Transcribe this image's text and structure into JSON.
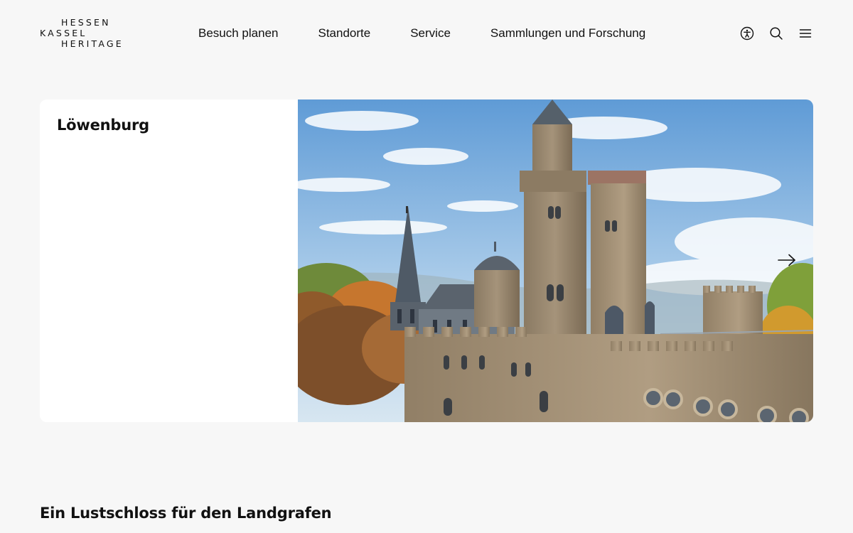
{
  "brand": {
    "line1": "HESSEN",
    "line2": "KASSEL",
    "line3": "HERITAGE"
  },
  "nav": {
    "items": [
      {
        "label": "Besuch planen"
      },
      {
        "label": "Standorte"
      },
      {
        "label": "Service"
      },
      {
        "label": "Sammlungen und Forschung"
      }
    ]
  },
  "header_actions": {
    "icons": [
      "accessibility-icon",
      "search-icon",
      "menu-icon"
    ]
  },
  "hero": {
    "title": "Löwenburg",
    "image_subject": "castle-photo",
    "next_icon": "arrow-right-icon"
  },
  "section": {
    "title": "Ein Lustschloss für den Landgrafen"
  },
  "colors": {
    "background": "#f7f7f7",
    "card": "#ffffff",
    "text": "#111111"
  }
}
